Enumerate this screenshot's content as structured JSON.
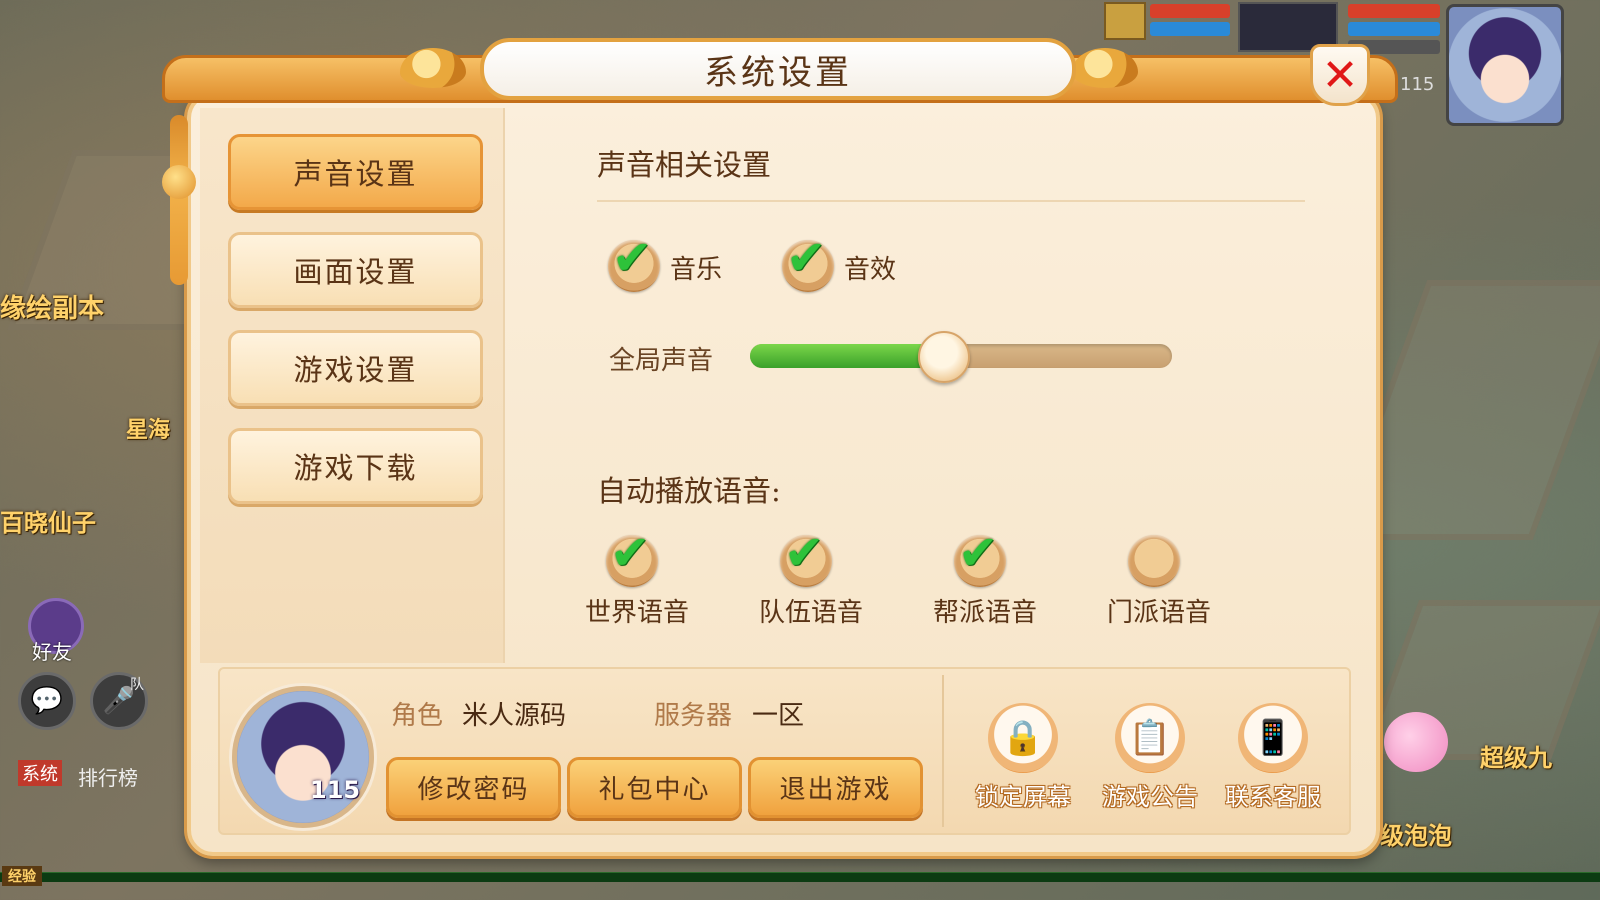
{
  "dialog": {
    "title": "系统设置",
    "close_symbol": "✕"
  },
  "sidebar": {
    "items": [
      {
        "label": "声音设置",
        "active": true
      },
      {
        "label": "画面设置",
        "active": false
      },
      {
        "label": "游戏设置",
        "active": false
      },
      {
        "label": "游戏下载",
        "active": false
      }
    ]
  },
  "sound": {
    "section_title": "声音相关设置",
    "music": {
      "label": "音乐",
      "checked": true
    },
    "sfx": {
      "label": "音效",
      "checked": true
    },
    "global_volume": {
      "label": "全局声音",
      "value": 0.46
    }
  },
  "auto_voice": {
    "title": "自动播放语音:",
    "options": [
      {
        "label": "世界语音",
        "checked": true
      },
      {
        "label": "队伍语音",
        "checked": true
      },
      {
        "label": "帮派语音",
        "checked": true
      },
      {
        "label": "门派语音",
        "checked": false
      }
    ]
  },
  "account": {
    "role_key": "角色",
    "role_value": "米人源码",
    "server_key": "服务器",
    "server_value": "一区",
    "level": "115",
    "buttons": [
      "修改密码",
      "礼包中心",
      "退出游戏"
    ]
  },
  "utilities": [
    {
      "label": "锁定屏幕",
      "icon": "lock-icon"
    },
    {
      "label": "游戏公告",
      "icon": "notice-icon"
    },
    {
      "label": "联系客服",
      "icon": "phone-icon"
    }
  ],
  "background": {
    "labels": [
      "缘绘副本",
      "星海",
      "百晓仙子",
      "好友",
      "超级九",
      "级泡泡",
      "排行榜",
      "系统",
      "队",
      "经验"
    ],
    "hud_level": "115"
  },
  "colors": {
    "accent_orange": "#f3a94a",
    "check_green": "#2ec23a",
    "close_red": "#e01818",
    "text_brown": "#5a3416"
  }
}
